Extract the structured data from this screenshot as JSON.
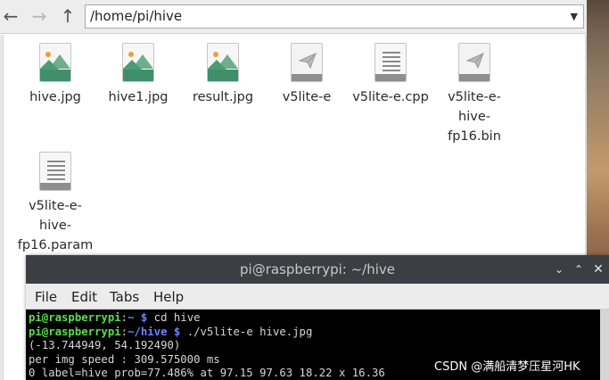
{
  "file_manager": {
    "path": "/home/pi/hive",
    "nav": {
      "back": "←",
      "forward": "→",
      "up": "↑",
      "dropdown": "▼"
    },
    "files": [
      {
        "label": "hive.jpg",
        "icon": "image-file-icon"
      },
      {
        "label": "hive1.jpg",
        "icon": "image-file-icon"
      },
      {
        "label": "result.jpg",
        "icon": "image-file-icon"
      },
      {
        "label": "v5lite-e",
        "icon": "executable-file-icon"
      },
      {
        "label": "v5lite-e.cpp",
        "icon": "text-file-icon"
      },
      {
        "label": "v5lite-e-\nhive-\nfp16.bin",
        "icon": "executable-file-icon"
      },
      {
        "label": "v5lite-e-\nhive-\nfp16.param",
        "icon": "text-file-icon"
      }
    ]
  },
  "terminal": {
    "title": "pi@raspberrypi: ~/hive",
    "controls": {
      "minimize": "⌄",
      "maximize": "⌃",
      "close": "✕"
    },
    "menu": [
      "File",
      "Edit",
      "Tabs",
      "Help"
    ],
    "lines": [
      {
        "user": "pi@raspberrypi",
        "sep": ":",
        "path": "~ $",
        "cmd": " cd hive"
      },
      {
        "user": "pi@raspberrypi",
        "sep": ":",
        "path": "~/hive $",
        "cmd": " ./v5lite-e hive.jpg"
      },
      {
        "text": "(-13.744949, 54.192490)"
      },
      {
        "text": "per img speed : 309.575000 ms"
      },
      {
        "text": "0 label=hive prob=77.486% at 97.15 97.63 18.22 x 16.36"
      }
    ]
  },
  "watermark": "CSDN @满船清梦压星河HK"
}
